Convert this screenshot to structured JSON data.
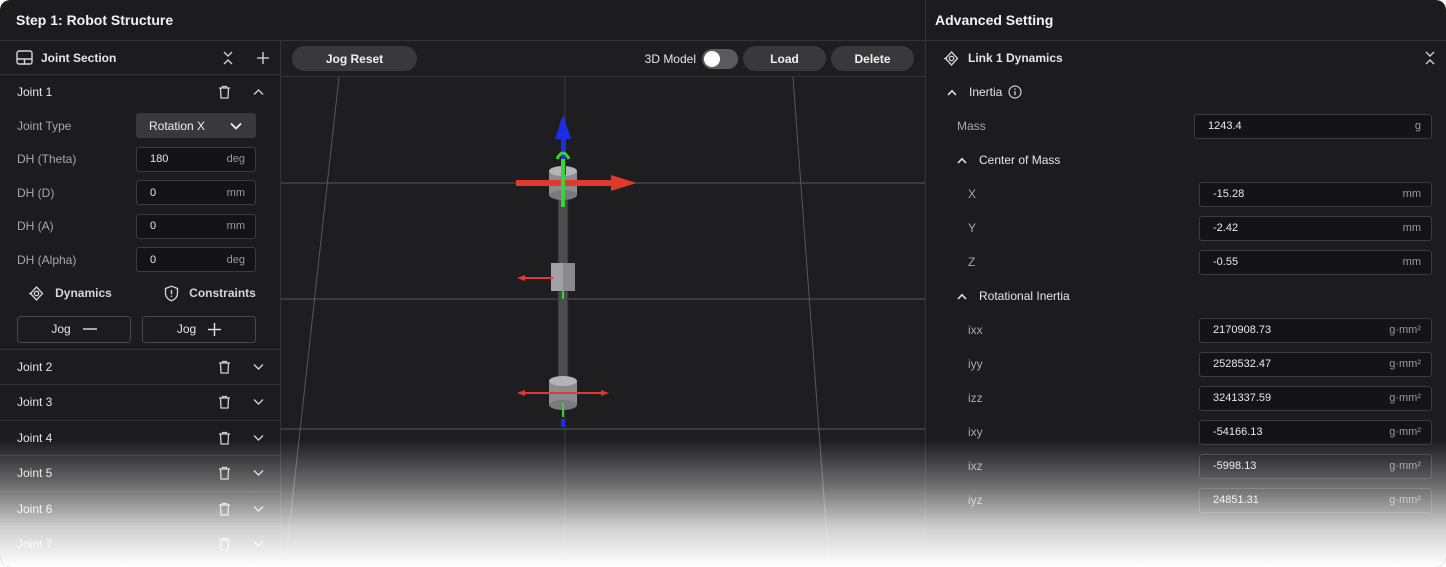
{
  "header": {
    "left_title": "Step 1: Robot Structure",
    "right_title": "Advanced Setting"
  },
  "joint_section": {
    "title": "Joint Section",
    "joint1": {
      "name": "Joint 1",
      "joint_type_label": "Joint Type",
      "joint_type_value": "Rotation X",
      "fields": [
        {
          "label": "DH (Theta)",
          "value": "180",
          "unit": "deg"
        },
        {
          "label": "DH (D)",
          "value": "0",
          "unit": "mm"
        },
        {
          "label": "DH (A)",
          "value": "0",
          "unit": "mm"
        },
        {
          "label": "DH (Alpha)",
          "value": "0",
          "unit": "deg"
        }
      ],
      "dynamics_label": "Dynamics",
      "constraints_label": "Constraints",
      "jog_minus_label": "Jog",
      "jog_plus_label": "Jog"
    },
    "collapsed_joints": [
      "Joint 2",
      "Joint 3",
      "Joint 4",
      "Joint 5",
      "Joint 6",
      "Joint 7"
    ]
  },
  "viewport": {
    "jog_reset_label": "Jog Reset",
    "model_toggle_label": "3D Model",
    "model_toggle_on": false,
    "load_label": "Load",
    "delete_label": "Delete"
  },
  "advanced": {
    "link_title": "Link 1 Dynamics",
    "inertia_label": "Inertia",
    "mass": {
      "label": "Mass",
      "value": "1243.4",
      "unit": "g"
    },
    "com_label": "Center of Mass",
    "com": [
      {
        "label": "X",
        "value": "-15.28",
        "unit": "mm"
      },
      {
        "label": "Y",
        "value": "-2.42",
        "unit": "mm"
      },
      {
        "label": "Z",
        "value": "-0.55",
        "unit": "mm"
      }
    ],
    "rot_label": "Rotational Inertia",
    "rot": [
      {
        "label": "ixx",
        "value": "2170908.73",
        "unit": "g·mm²"
      },
      {
        "label": "iyy",
        "value": "2528532.47",
        "unit": "g·mm²"
      },
      {
        "label": "izz",
        "value": "3241337.59",
        "unit": "g·mm²"
      },
      {
        "label": "ixy",
        "value": "-54166.13",
        "unit": "g·mm²"
      },
      {
        "label": "ixz",
        "value": "-5998.13",
        "unit": "g·mm²"
      },
      {
        "label": "iyz",
        "value": "24851.31",
        "unit": "g·mm²"
      }
    ]
  },
  "colors": {
    "axis_x": "#e03a2f",
    "axis_y": "#3bd13b",
    "axis_z": "#1a2ee6",
    "link": "#4d4d50"
  }
}
